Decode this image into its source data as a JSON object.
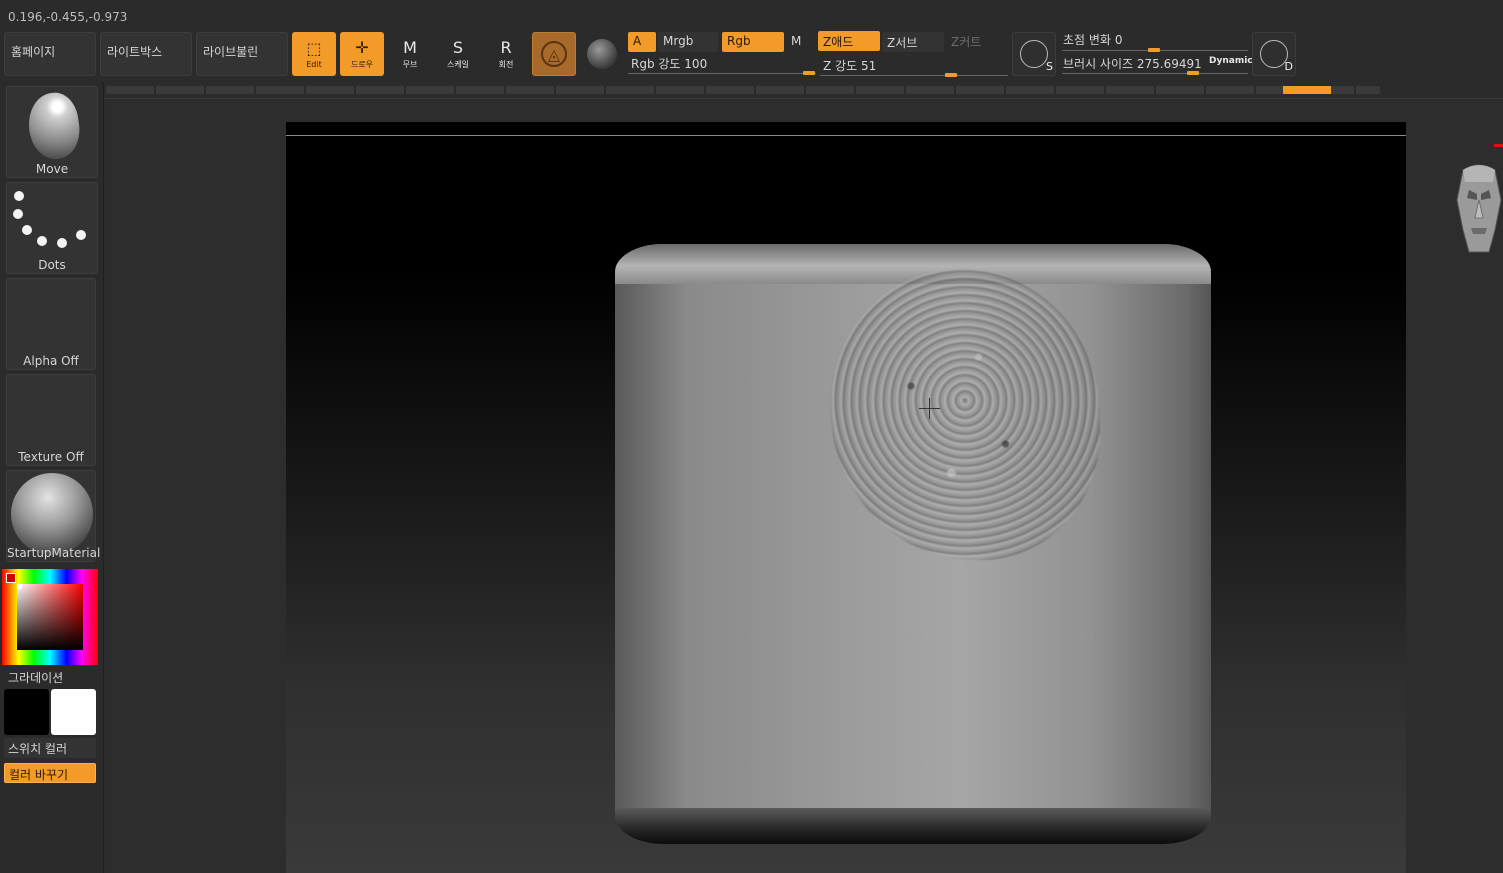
{
  "coords": "0.196,-0.455,-0.973",
  "nav": {
    "home": "홈페이지",
    "lightbox": "라이트박스",
    "liveboolean": "라이브불린"
  },
  "tools": {
    "edit": {
      "label": "Edit",
      "icon": "edit-icon"
    },
    "draw": {
      "label": "드로우",
      "icon": "draw-icon"
    },
    "move": {
      "label": "무브",
      "letter": "M",
      "icon": "move-icon"
    },
    "scale": {
      "label": "스케일",
      "letter": "S",
      "icon": "scale-icon"
    },
    "rotate": {
      "label": "회전",
      "letter": "R",
      "icon": "rotate-icon"
    }
  },
  "pills": {
    "a": "A",
    "mrgb": "Mrgb",
    "rgb": "Rgb",
    "m": "M",
    "zadd": "Z애드",
    "zsub": "Z서브",
    "zcut": "Z커트"
  },
  "sliders": {
    "rgb_intensity": {
      "label": "Rgb 강도",
      "value": "100"
    },
    "z_intensity": {
      "label": "Z 강도",
      "value": "51"
    },
    "focal_shift": {
      "label": "초점 변화",
      "value": "0"
    },
    "draw_size": {
      "label": "브러시 사이즈",
      "value": "275.69491"
    },
    "dynamic": "Dynamic"
  },
  "sym": {
    "s": "S",
    "d": "D"
  },
  "left": {
    "brush": "Move",
    "stroke": "Dots",
    "alpha": "Alpha Off",
    "texture": "Texture Off",
    "material": "StartupMaterial",
    "gradient": "그라데이션",
    "switch_color": "스위치 컬러",
    "change_color": "컬러 바꾸기"
  },
  "colors": {
    "accent": "#f29b28",
    "main_color": "#000000",
    "secondary_color": "#ffffff"
  }
}
